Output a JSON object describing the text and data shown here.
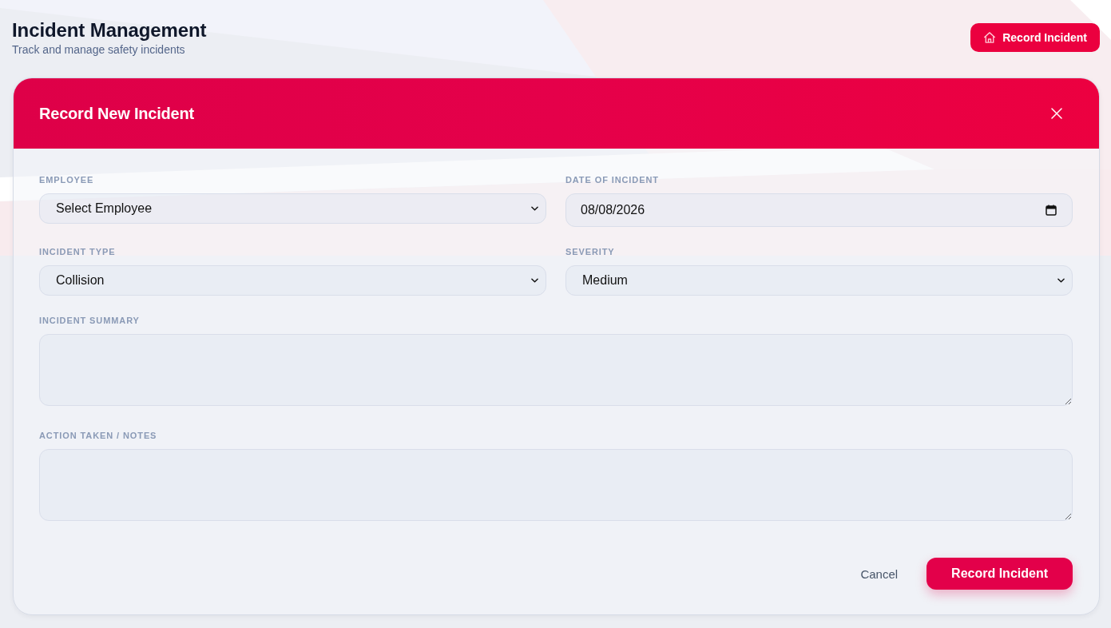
{
  "header": {
    "title": "Incident Management",
    "subtitle": "Track and manage safety incidents",
    "action_button": {
      "label": "Record Incident"
    }
  },
  "modal": {
    "title": "Record New Incident",
    "fields": [
      {
        "kind": "select",
        "label": "EMPLOYEE",
        "value": "Select Employee"
      },
      {
        "kind": "date",
        "label": "DATE OF INCIDENT",
        "value": "08/08/2026"
      },
      {
        "kind": "select",
        "label": "INCIDENT TYPE",
        "value": "Collision"
      },
      {
        "kind": "select",
        "label": "SEVERITY",
        "value": "Medium"
      },
      {
        "kind": "textarea",
        "label": "INCIDENT SUMMARY"
      },
      {
        "kind": "textarea",
        "label": "ACTION TAKEN / NOTES"
      }
    ],
    "buttons": [
      {
        "kind": "secondary",
        "label": "Cancel"
      },
      {
        "kind": "primary",
        "label": "Record Incident"
      }
    ]
  }
}
